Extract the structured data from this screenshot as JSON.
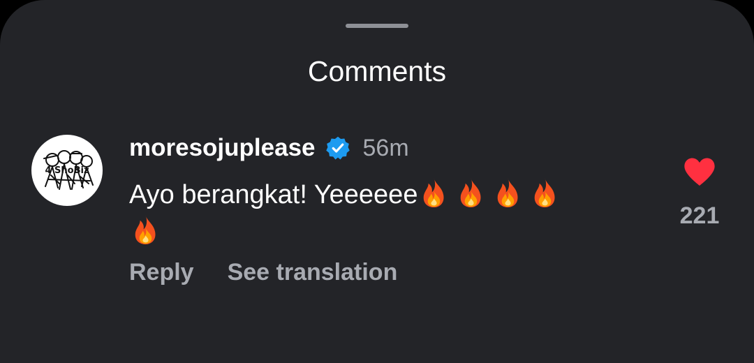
{
  "sheet": {
    "title": "Comments"
  },
  "comment": {
    "avatar_logo_text": "4 ShoBiz",
    "username": "moresojuplease",
    "verified": true,
    "timestamp": "56m",
    "text": "Ayo berangkat! Yeeeeee",
    "emoji_icons": [
      "fire-icon",
      "fire-icon",
      "fire-icon",
      "fire-icon",
      "fire-icon"
    ],
    "like_count": "221",
    "liked": true,
    "actions": {
      "reply_label": "Reply",
      "translate_label": "See translation"
    }
  },
  "colors": {
    "sheet_background": "#232428",
    "text_primary": "#ffffff",
    "text_secondary": "#a8abb2",
    "verified_badge": "#1d9bf0",
    "heart": "#ff3040"
  }
}
